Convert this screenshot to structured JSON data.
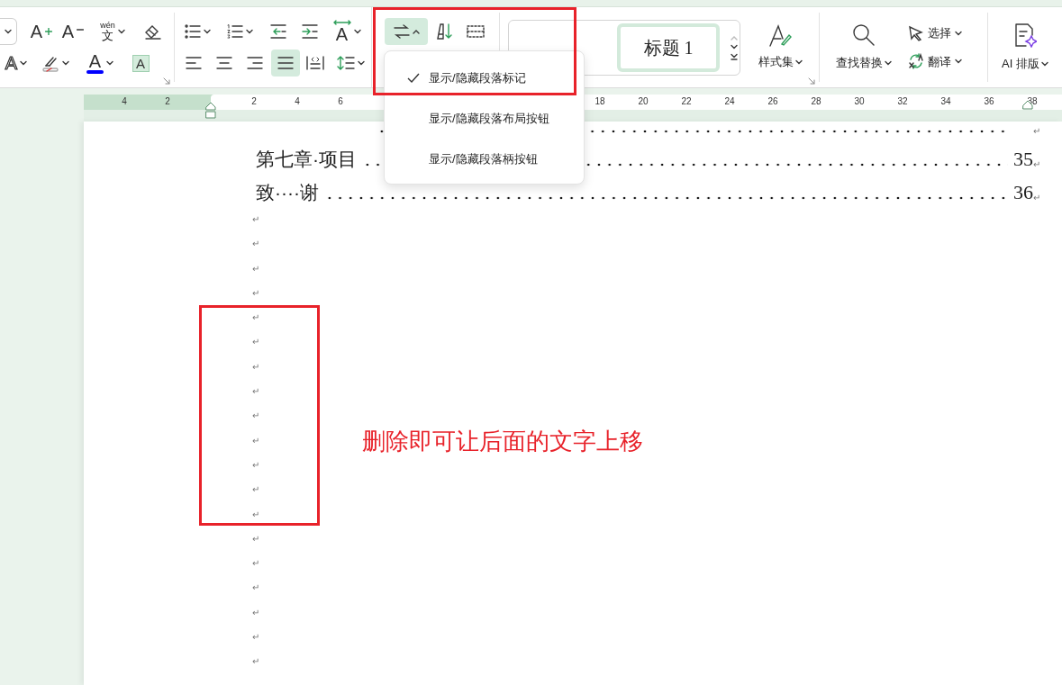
{
  "toolbar": {
    "font_row1": [
      {
        "kind": "font-grow",
        "glyph": "A"
      },
      {
        "kind": "font-shrink",
        "glyph": "A"
      },
      {
        "kind": "pinyin",
        "glyph": "文",
        "ruby": "wén"
      },
      {
        "kind": "eraser"
      }
    ],
    "font_row2": [
      {
        "kind": "text-effect",
        "glyph": "A"
      },
      {
        "kind": "highlight"
      },
      {
        "kind": "font-color",
        "glyph": "A"
      },
      {
        "kind": "shading",
        "glyph": "A"
      }
    ],
    "para_row1": [
      {
        "kind": "bullets"
      },
      {
        "kind": "numbering"
      },
      {
        "kind": "outdent"
      },
      {
        "kind": "indent"
      },
      {
        "kind": "direction",
        "glyph": "A"
      }
    ],
    "para_row2": [
      {
        "kind": "align-left",
        "selected": false
      },
      {
        "kind": "align-center",
        "selected": false
      },
      {
        "kind": "align-right",
        "selected": false
      },
      {
        "kind": "justify",
        "selected": true
      },
      {
        "kind": "distribute",
        "selected": false
      },
      {
        "kind": "line-spacing"
      }
    ],
    "marks_group": [
      {
        "kind": "paragraph-marks",
        "expanded": true
      },
      {
        "kind": "sort"
      },
      {
        "kind": "table-border"
      }
    ],
    "styles": [
      {
        "selected": false
      },
      {
        "label": "标题 1",
        "selected": true
      }
    ],
    "style_set": {
      "label": "样式集"
    },
    "find_replace": {
      "label": "查找替换"
    },
    "select": {
      "label": "选择"
    },
    "translate": {
      "label": "翻译"
    },
    "ai_layout": {
      "label": "AI 排版"
    }
  },
  "menu": {
    "items": [
      {
        "label": "显示/隐藏段落标记",
        "checked": true
      },
      {
        "label": "显示/隐藏段落布局按钮",
        "checked": false
      },
      {
        "label": "显示/隐藏段落柄按钮",
        "checked": false
      }
    ]
  },
  "ruler": {
    "left_ticks": [
      "4",
      "2"
    ],
    "right_ticks": [
      "2",
      "4",
      "6",
      "18",
      "20",
      "22",
      "24",
      "26",
      "28",
      "30",
      "32",
      "34",
      "36",
      "38"
    ]
  },
  "document": {
    "toc": [
      {
        "mark": "↵"
      },
      {
        "title": "第七章·项目",
        "page": "35",
        "mark": "↵"
      },
      {
        "title": "致····谢",
        "page": "36",
        "mark": "↵"
      }
    ],
    "empty_paragraphs": [
      {
        "mark": "↵"
      },
      {
        "mark": "↵"
      },
      {
        "mark": "↵"
      },
      {
        "mark": "↵"
      },
      {
        "mark": "↵"
      },
      {
        "mark": "↵"
      },
      {
        "mark": "↵"
      },
      {
        "mark": "↵"
      },
      {
        "mark": "↵"
      },
      {
        "mark": "↵"
      },
      {
        "mark": "↵"
      },
      {
        "mark": "↵"
      },
      {
        "mark": "↵"
      },
      {
        "mark": "↵"
      },
      {
        "mark": "↵"
      },
      {
        "mark": "↵"
      },
      {
        "mark": "↵"
      },
      {
        "mark": "↵"
      },
      {
        "mark": "↵"
      }
    ]
  },
  "annotation": {
    "text": "删除即可让后面的文字上移"
  }
}
